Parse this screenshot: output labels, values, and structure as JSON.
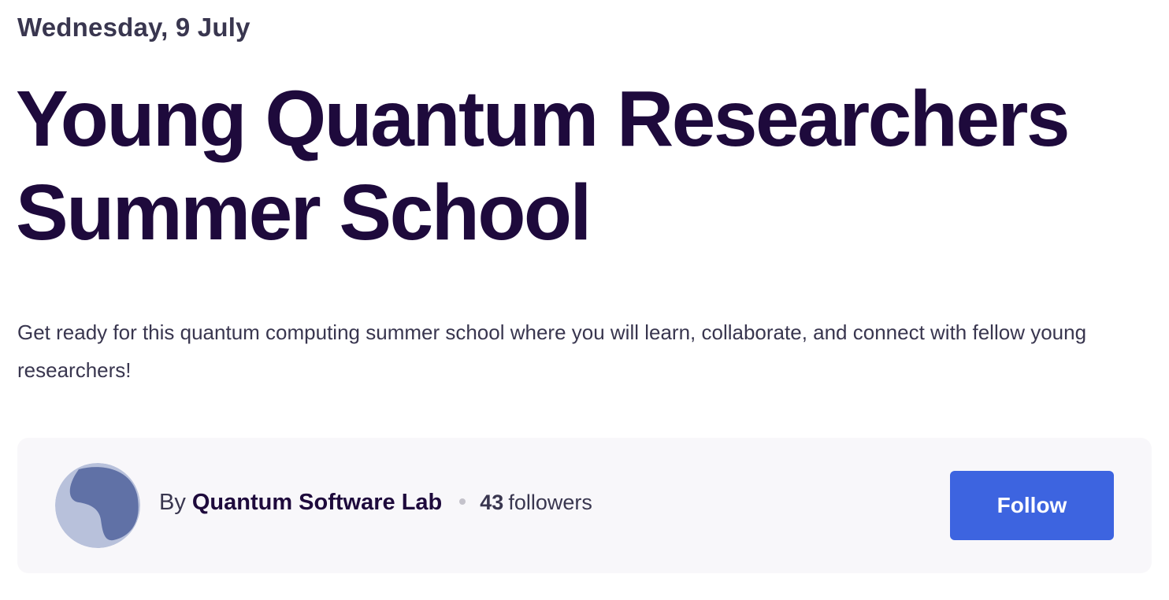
{
  "event": {
    "date": "Wednesday, 9 July",
    "title": "Young Quantum Researchers Summer School",
    "summary": "Get ready for this quantum computing summer school where you will learn, collaborate, and connect with fellow young researchers!"
  },
  "organizer": {
    "by_label": "By",
    "name": "Quantum Software Lab",
    "followers_count": "43",
    "followers_label": "followers",
    "follow_label": "Follow",
    "avatar_icon": "organizer-avatar-blob-icon"
  },
  "colors": {
    "title": "#1e0a3c",
    "body_text": "#39364f",
    "card_background": "#f8f7fa",
    "follow_button": "#3d64e0",
    "avatar_background": "#b8c1db",
    "avatar_shape": "#6071a6"
  }
}
